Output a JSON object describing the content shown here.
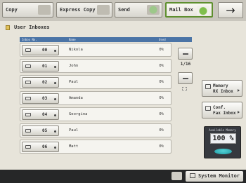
{
  "tabs": [
    {
      "label": "Copy",
      "icon": "copier-icon",
      "active": false
    },
    {
      "label": "Express Copy",
      "icon": "express-copy-icon",
      "active": false
    },
    {
      "label": "Send",
      "icon": "send-icon",
      "active": false
    },
    {
      "label": "Mail Box",
      "icon": "mailbox-icon",
      "active": true
    }
  ],
  "next_arrow": "→",
  "title": "User Inboxes",
  "list_headers": {
    "box_no": "Inbox No.",
    "name": "Name",
    "used": "Used"
  },
  "inboxes": [
    {
      "number": "00",
      "name": "Nikola",
      "used": "0%"
    },
    {
      "number": "01",
      "name": "John",
      "used": "0%"
    },
    {
      "number": "02",
      "name": "Paul",
      "used": "0%"
    },
    {
      "number": "03",
      "name": "Amanda",
      "used": "0%"
    },
    {
      "number": "04",
      "name": "Georgina",
      "used": "0%"
    },
    {
      "number": "05",
      "name": "Paul",
      "used": "0%"
    },
    {
      "number": "06",
      "name": "Matt",
      "used": "0%"
    }
  ],
  "page_indicator": "1/16",
  "side_buttons": [
    {
      "line1": "Memory",
      "line2": "RX Inbox"
    },
    {
      "line1": "Conf.",
      "line2": "Fax Inbox"
    }
  ],
  "memory": {
    "title": "Available Memory",
    "value": "100 %"
  },
  "system_monitor": "System Monitor",
  "colors": {
    "active_tab_border": "#5e8f2e",
    "list_header": "#4b74a6",
    "memory_disk": "#1f9aa2"
  }
}
